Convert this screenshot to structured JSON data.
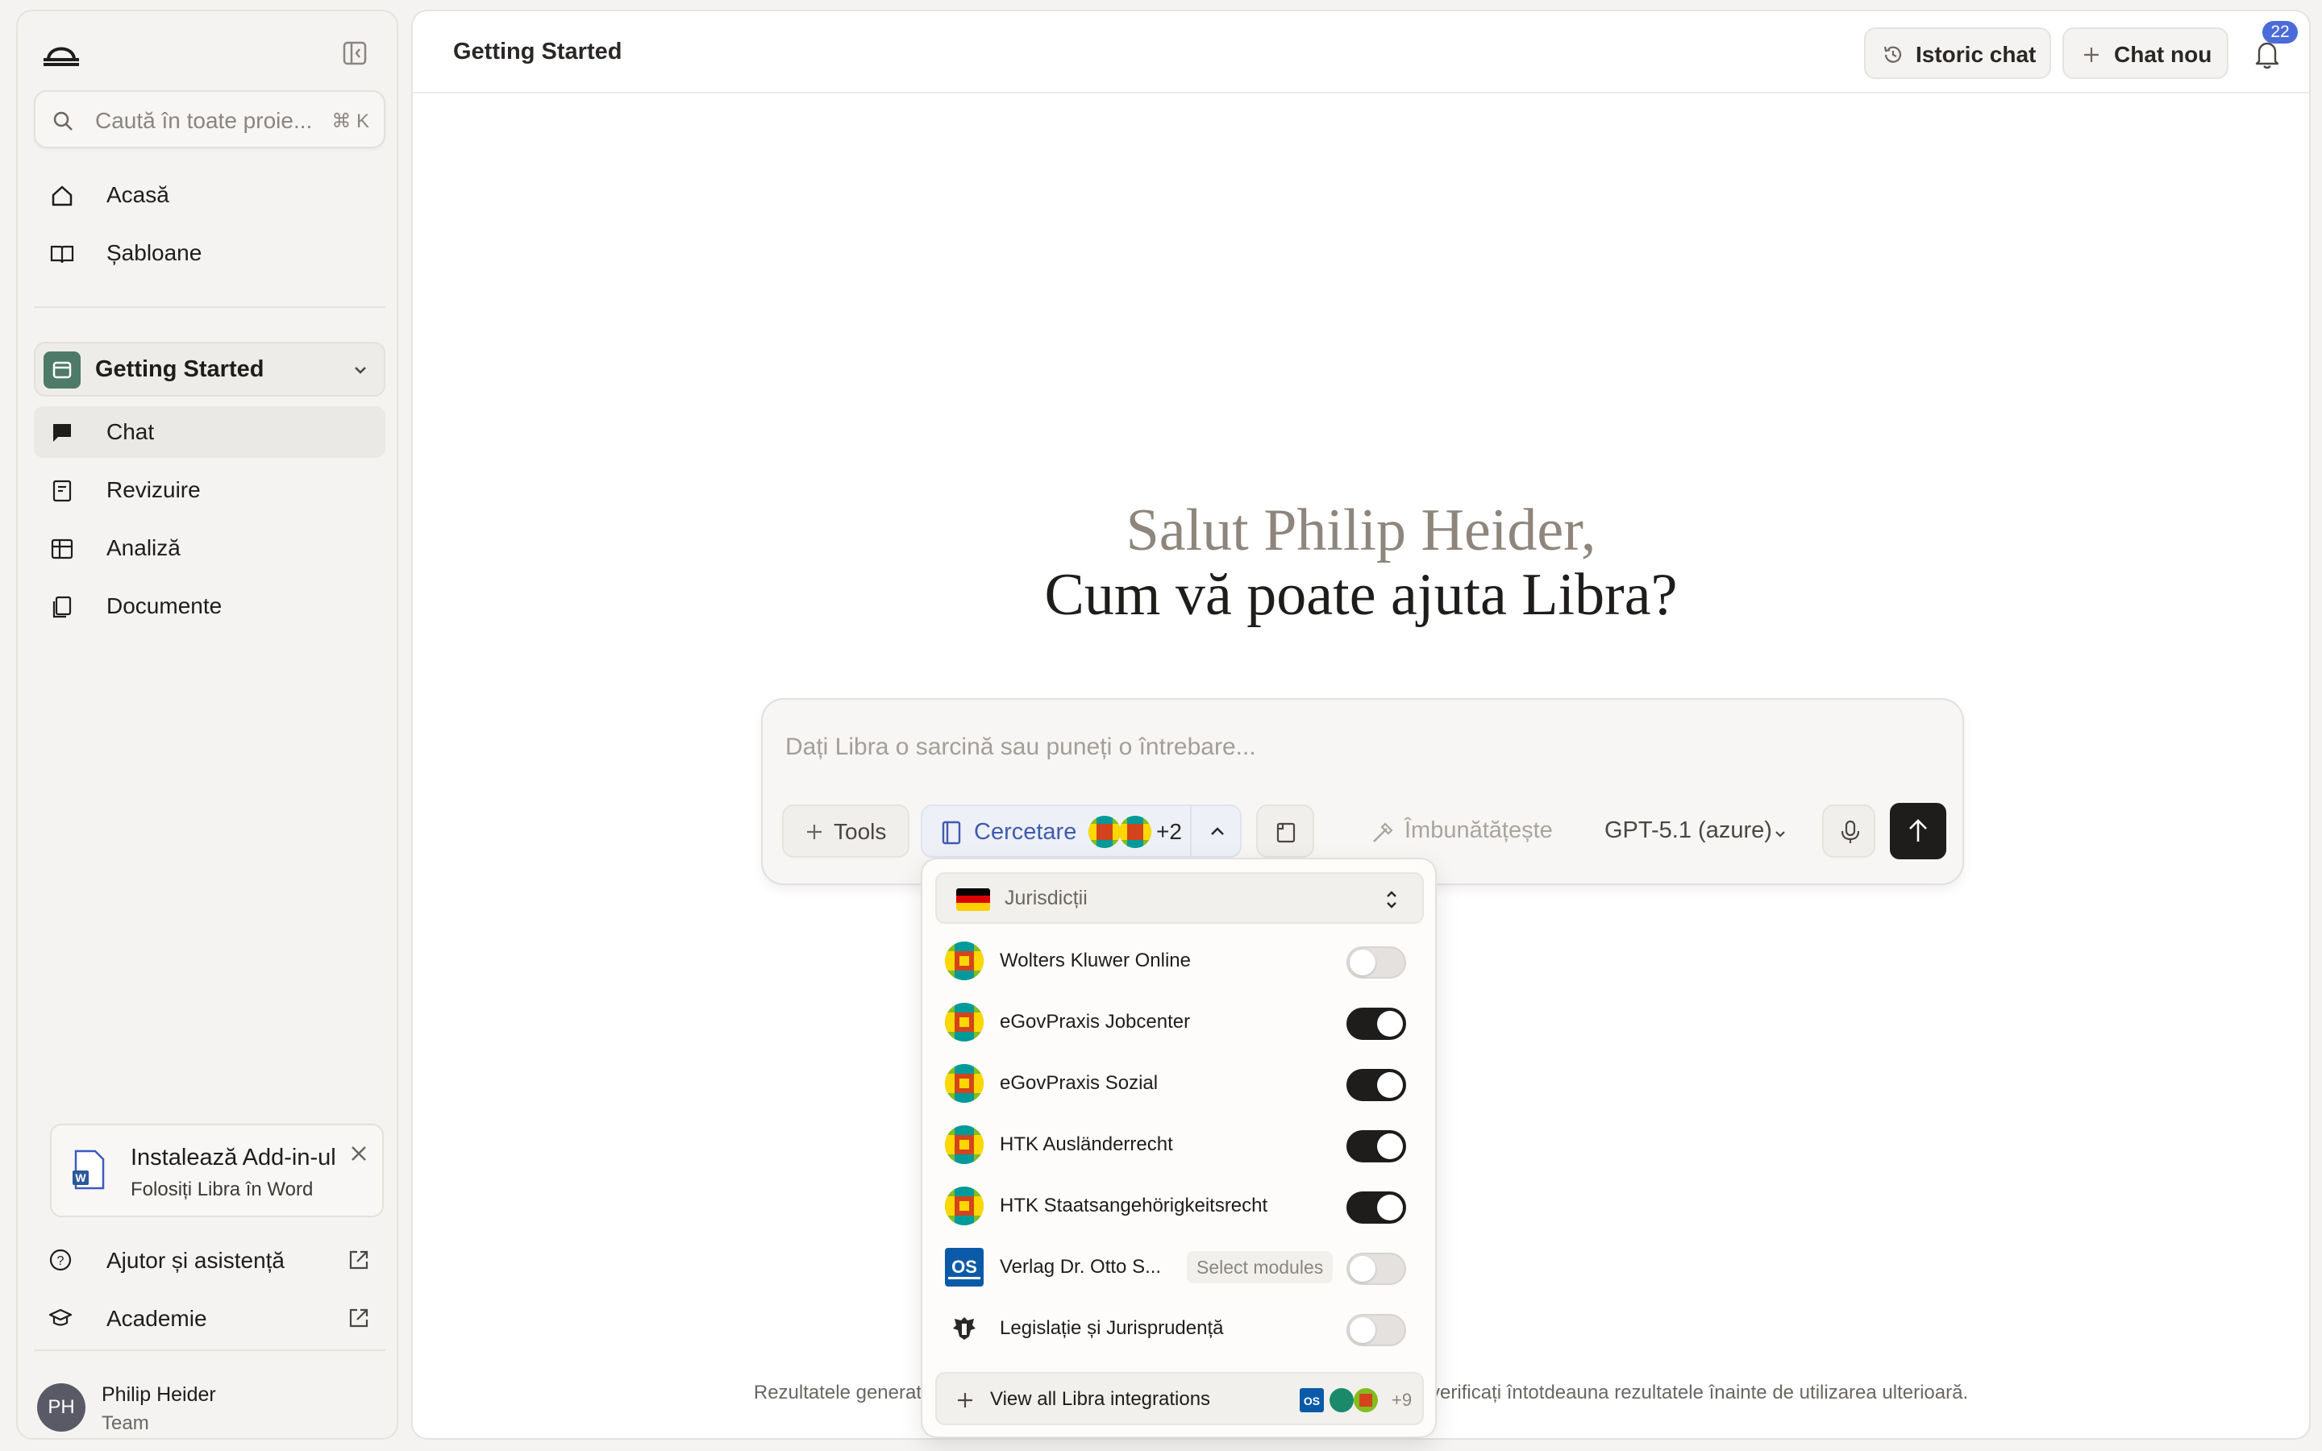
{
  "sidebar": {
    "search_placeholder": "Caută în toate proie...",
    "search_shortcut": "⌘ K",
    "nav": [
      {
        "label": "Acasă"
      },
      {
        "label": "Șabloane"
      }
    ],
    "project": {
      "label": "Getting Started"
    },
    "project_nav": [
      {
        "label": "Chat"
      },
      {
        "label": "Revizuire"
      },
      {
        "label": "Analiză"
      },
      {
        "label": "Documente"
      }
    ],
    "addin": {
      "title": "Instalează Add-in-ul",
      "subtitle": "Folosiți Libra în Word"
    },
    "footer": [
      {
        "label": "Ajutor și asistență"
      },
      {
        "label": "Academie"
      }
    ],
    "user": {
      "initials": "PH",
      "name": "Philip Heider",
      "team": "Team"
    }
  },
  "header": {
    "title": "Getting Started",
    "history_label": "Istoric chat",
    "new_chat_label": "Chat nou",
    "notifications": "22"
  },
  "greeting": {
    "line1": "Salut Philip Heider,",
    "line2": "Cum vă poate ajuta Libra?"
  },
  "composer": {
    "placeholder": "Dați Libra o sarcină sau puneți o întrebare...",
    "tools_label": "Tools",
    "research_label": "Cercetare",
    "research_extra": "+2",
    "improve_label": "Îmbunătățește",
    "model_label": "GPT-5.1 (azure)"
  },
  "dropdown": {
    "jurisdiction_label": "Jurisdicții",
    "integrations": [
      {
        "name": "Wolters Kluwer Online",
        "enabled": false,
        "logo": "wk"
      },
      {
        "name": "eGovPraxis Jobcenter",
        "enabled": true,
        "logo": "wk"
      },
      {
        "name": "eGovPraxis Sozial",
        "enabled": true,
        "logo": "wk"
      },
      {
        "name": "HTK Ausländerrecht",
        "enabled": true,
        "logo": "wk"
      },
      {
        "name": "HTK Staatsangehörigkeitsrecht",
        "enabled": true,
        "logo": "wk"
      },
      {
        "name": "Verlag Dr. Otto S...",
        "enabled": false,
        "logo": "os",
        "modules_label": "Select modules"
      },
      {
        "name": "Legislație și Jurisprudență",
        "enabled": false,
        "logo": "eagle"
      }
    ],
    "view_all_label": "View all Libra integrations",
    "view_all_extra": "+9"
  },
  "disclaimer": "Rezultatele generate de inteligența artificială nu constituie consultanță juridică; verificați întotdeauna rezultatele înainte de utilizarea ulterioară.",
  "colors": {
    "accent_blue": "#3e5bb0",
    "toggle_on": "#1f1d1b",
    "badge": "#4a6cd8",
    "project_icon": "#4e7a6a"
  }
}
